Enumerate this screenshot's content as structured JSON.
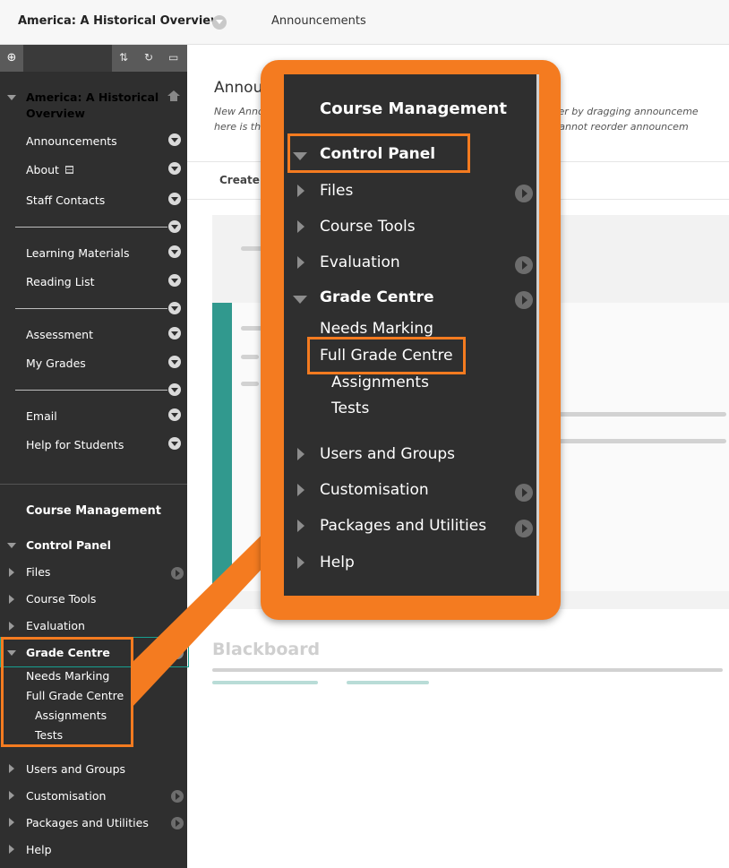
{
  "topbar": {
    "course_title": "America: A Historical Overview",
    "breadcrumb": "Announcements"
  },
  "sidebar": {
    "course_title": "America: A Historical Overview",
    "items": [
      {
        "label": "Announcements"
      },
      {
        "label": "About"
      },
      {
        "label": "Staff Contacts"
      },
      {
        "label": "Learning Materials"
      },
      {
        "label": "Reading List"
      },
      {
        "label": "Assessment"
      },
      {
        "label": "My Grades"
      },
      {
        "label": "Email"
      },
      {
        "label": "Help for Students"
      }
    ],
    "course_management": {
      "heading": "Course Management",
      "control_panel": "Control Panel",
      "files": "Files",
      "course_tools": "Course Tools",
      "evaluation": "Evaluation",
      "grade_centre": "Grade Centre",
      "needs_marking": "Needs Marking",
      "full_grade_centre": "Full Grade Centre",
      "assignments": "Assignments",
      "tests": "Tests",
      "users_and_groups": "Users and Groups",
      "customisation": "Customisation",
      "packages_and_utilities": "Packages and Utilities",
      "help": "Help"
    }
  },
  "main": {
    "page_title": "Annou",
    "note_line1": "New Anno",
    "note_line1_right": "reorder by dragging announceme",
    "note_line2": "here is th",
    "note_line2_right": "and cannot reorder announcem",
    "create_label": "Create",
    "footer_title": "Blackboard"
  },
  "callout": {
    "heading": "Course Management",
    "control_panel": "Control Panel",
    "files": "Files",
    "course_tools": "Course Tools",
    "evaluation": "Evaluation",
    "grade_centre": "Grade Centre",
    "needs_marking": "Needs Marking",
    "full_grade_centre": "Full Grade Centre",
    "assignments": "Assignments",
    "tests": "Tests",
    "users_and_groups": "Users and Groups",
    "customisation": "Customisation",
    "packages_and_utilities": "Packages and Utilities",
    "help": "Help"
  },
  "colors": {
    "highlight": "#f47b20",
    "sidebar_bg": "#2f2f2f",
    "accent": "#0f8a7c"
  }
}
